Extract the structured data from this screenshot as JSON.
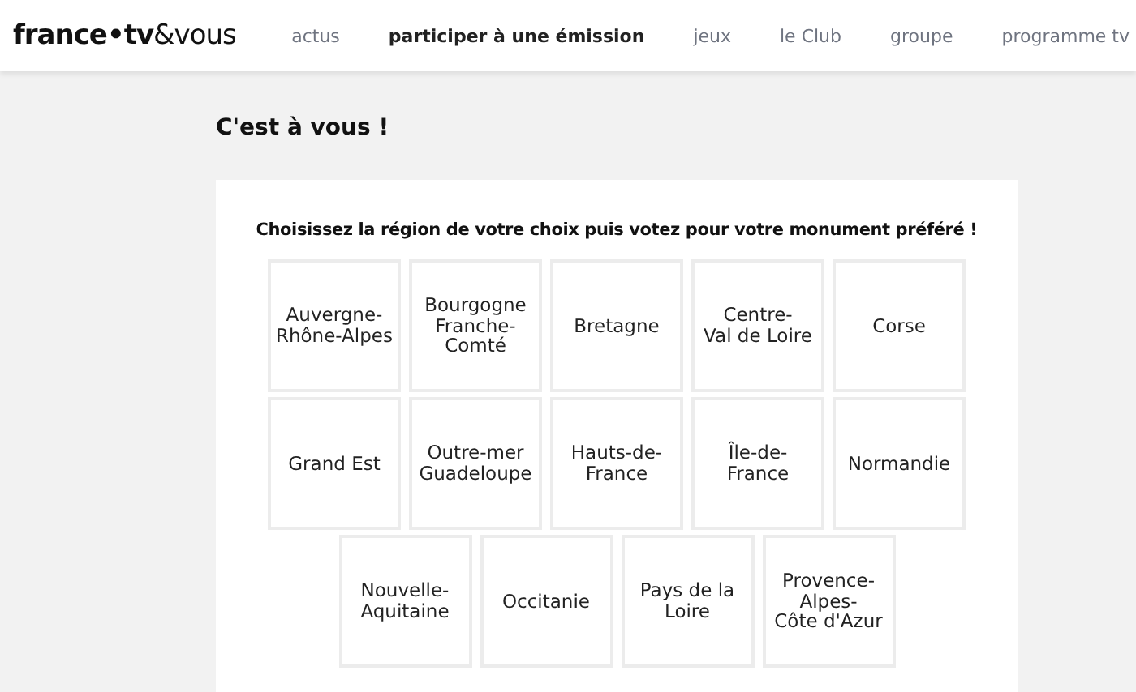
{
  "header": {
    "logo": "**france•tv**&vous",
    "nav": [
      {
        "label": "actus",
        "selected": false
      },
      {
        "label": "participer à une émission",
        "selected": true
      },
      {
        "label": "jeux",
        "selected": false
      },
      {
        "label": "le Club",
        "selected": false
      },
      {
        "label": "groupe",
        "selected": false
      },
      {
        "label": "programme tv",
        "selected": false
      }
    ]
  },
  "page_title": "C'est à vous !",
  "card": {
    "instruction": "Choisissez la région de votre choix puis votez pour votre monument préféré !",
    "regions": [
      [
        "Auvergne-\nRhône-Alpes",
        "Bourgogne\nFranche-\nComté",
        "Bretagne",
        "Centre-\nVal de Loire",
        "Corse"
      ],
      [
        "Grand Est",
        "Outre-mer\nGuadeloupe",
        "Hauts-de-\nFrance",
        "Île-de-\nFrance",
        "Normandie"
      ],
      [
        "Nouvelle-\nAquitaine",
        "Occitanie",
        "Pays de la\nLoire",
        "Provence-\nAlpes-\nCôte d'Azur"
      ]
    ]
  }
}
